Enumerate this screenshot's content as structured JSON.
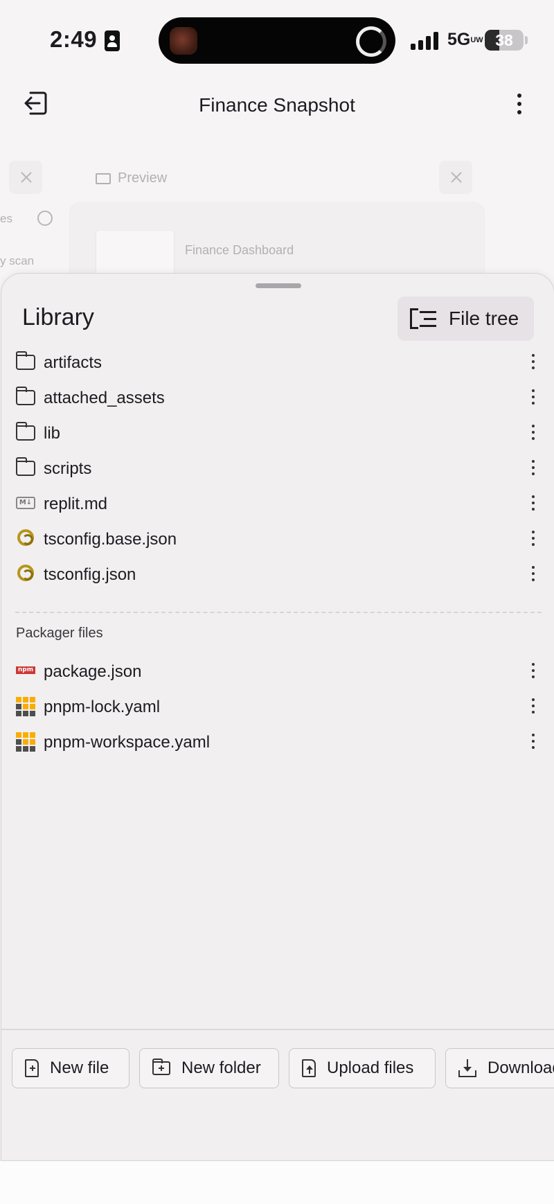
{
  "status_bar": {
    "time": "2:49",
    "network": "5G",
    "network_sub": "UW",
    "battery_level": "38"
  },
  "header": {
    "title": "Finance Snapshot"
  },
  "background": {
    "preview_tab": "Preview",
    "side_text_1": "es",
    "side_text_2": "y scan",
    "card_title": "Finance Dashboard"
  },
  "library": {
    "title": "Library",
    "file_tree_label": "File tree",
    "items": [
      {
        "name": "artifacts",
        "type": "folder"
      },
      {
        "name": "attached_assets",
        "type": "folder"
      },
      {
        "name": "lib",
        "type": "folder"
      },
      {
        "name": "scripts",
        "type": "folder"
      },
      {
        "name": "replit.md",
        "type": "markdown"
      },
      {
        "name": "tsconfig.base.json",
        "type": "tsconfig"
      },
      {
        "name": "tsconfig.json",
        "type": "tsconfig"
      }
    ],
    "packager_label": "Packager files",
    "packager_items": [
      {
        "name": "package.json",
        "type": "npm"
      },
      {
        "name": "pnpm-lock.yaml",
        "type": "pnpm"
      },
      {
        "name": "pnpm-workspace.yaml",
        "type": "pnpm"
      }
    ]
  },
  "actions": {
    "new_file": "New file",
    "new_folder": "New folder",
    "upload_files": "Upload files",
    "download": "Download"
  },
  "icons": {
    "md_badge": "M↓",
    "npm_badge": "npm"
  },
  "colors": {
    "sheet_bg": "#f2eff1",
    "npm_red": "#cb3837",
    "pnpm_yellow": "#f9ad00",
    "tsconfig_gold": "#b7961a"
  }
}
